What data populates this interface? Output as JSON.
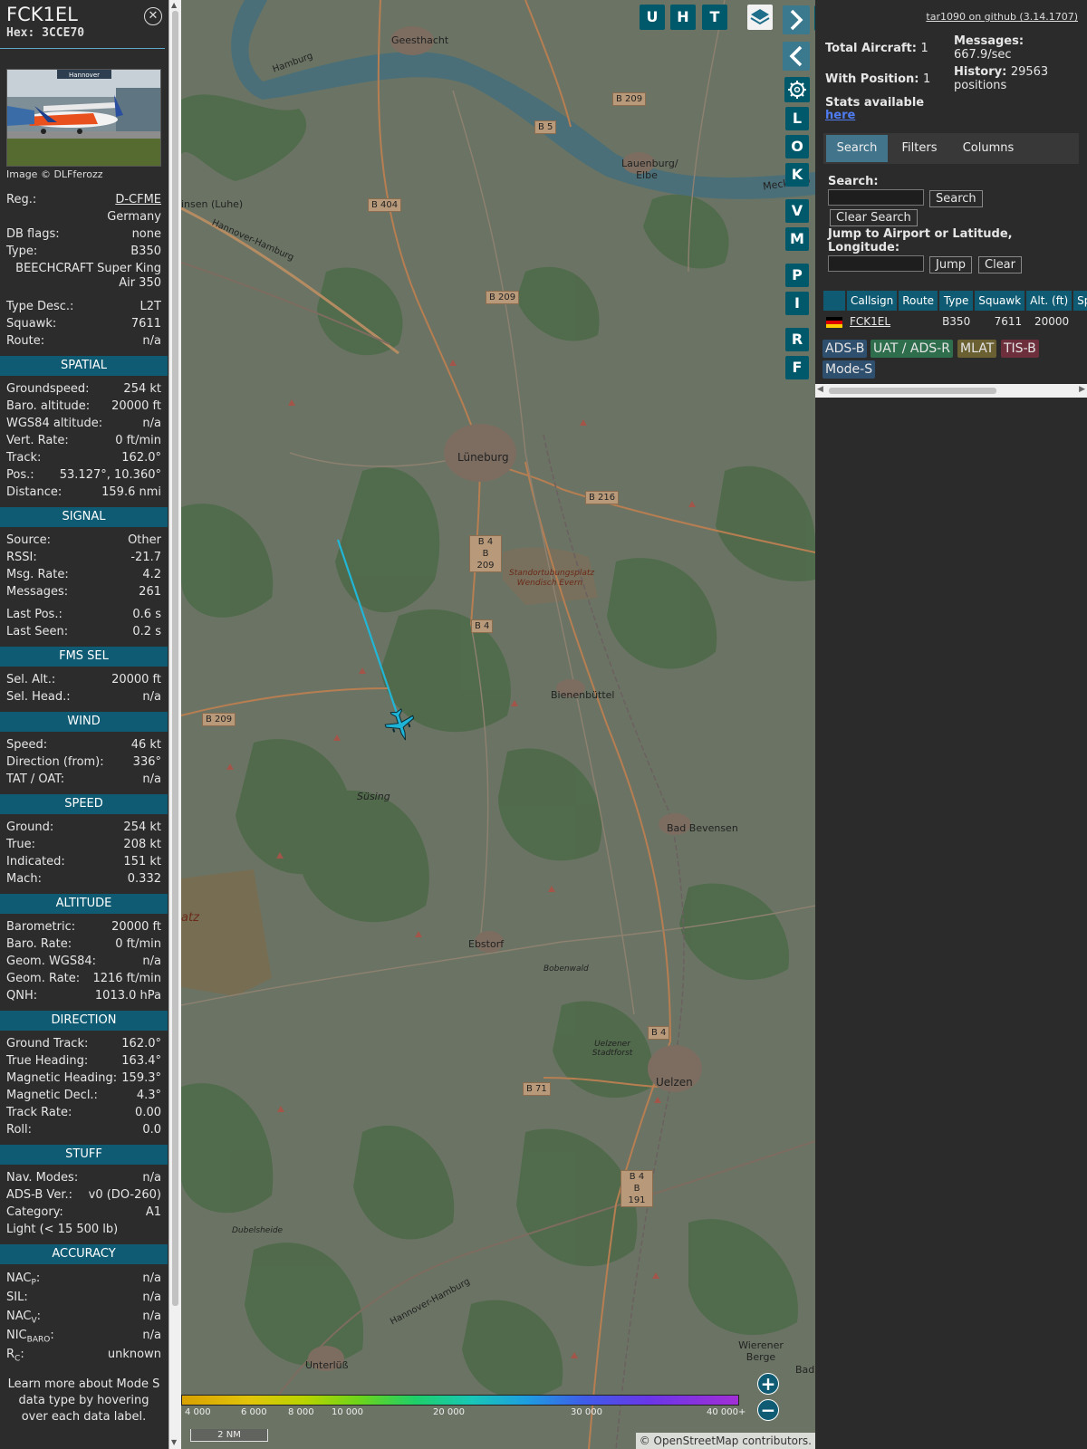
{
  "aircraft": {
    "callsign": "FCK1EL",
    "hex_label": "Hex: 3CCE70",
    "photo_credit": "Image © DLFferozz",
    "photo_banner": "Hannover",
    "reg_label": "Reg.:",
    "reg_value": "D-CFME",
    "country": "Germany",
    "dbflags_label": "DB flags:",
    "dbflags_value": "none",
    "type_label": "Type:",
    "type_value": "B350",
    "type_full": "BEECHCRAFT Super King Air 350",
    "typedesc_label": "Type Desc.:",
    "typedesc_value": "L2T",
    "squawk_label": "Squawk:",
    "squawk_value": "7611",
    "route_label": "Route:",
    "route_value": "n/a"
  },
  "sections": {
    "spatial": "SPATIAL",
    "signal": "SIGNAL",
    "fms": "FMS SEL",
    "wind": "WIND",
    "speed": "SPEED",
    "altitude": "ALTITUDE",
    "direction": "DIRECTION",
    "stuff": "STUFF",
    "accuracy": "ACCURACY"
  },
  "spatial": [
    {
      "label": "Groundspeed:",
      "value": "254 kt"
    },
    {
      "label": "Baro. altitude:",
      "value": "20000 ft"
    },
    {
      "label": "WGS84 altitude:",
      "value": "n/a"
    },
    {
      "label": "Vert. Rate:",
      "value": "0 ft/min"
    },
    {
      "label": "Track:",
      "value": "162.0°"
    },
    {
      "label": "Pos.:",
      "value": "53.127°, 10.360°"
    },
    {
      "label": "Distance:",
      "value": "159.6 nmi"
    }
  ],
  "signal": [
    {
      "label": "Source:",
      "value": "Other"
    },
    {
      "label": "RSSI:",
      "value": "-21.7"
    },
    {
      "label": "Msg. Rate:",
      "value": "4.2"
    },
    {
      "label": "Messages:",
      "value": "261"
    }
  ],
  "signal2": [
    {
      "label": "Last Pos.:",
      "value": "0.6 s"
    },
    {
      "label": "Last Seen:",
      "value": "0.2 s"
    }
  ],
  "fms": [
    {
      "label": "Sel. Alt.:",
      "value": "20000 ft"
    },
    {
      "label": "Sel. Head.:",
      "value": "n/a"
    }
  ],
  "wind": [
    {
      "label": "Speed:",
      "value": "46 kt"
    },
    {
      "label": "Direction (from):",
      "value": "336°"
    },
    {
      "label": "TAT / OAT:",
      "value": "n/a"
    }
  ],
  "speed": [
    {
      "label": "Ground:",
      "value": "254 kt"
    },
    {
      "label": "True:",
      "value": "208 kt"
    },
    {
      "label": "Indicated:",
      "value": "151 kt"
    },
    {
      "label": "Mach:",
      "value": "0.332"
    }
  ],
  "altitude": [
    {
      "label": "Barometric:",
      "value": "20000 ft"
    },
    {
      "label": "Baro. Rate:",
      "value": "0 ft/min"
    },
    {
      "label": "Geom. WGS84:",
      "value": "n/a"
    },
    {
      "label": "Geom. Rate:",
      "value": "1216 ft/min"
    },
    {
      "label": "QNH:",
      "value": "1013.0 hPa"
    }
  ],
  "direction": [
    {
      "label": "Ground Track:",
      "value": "162.0°"
    },
    {
      "label": "True Heading:",
      "value": "163.4°"
    },
    {
      "label": "Magnetic Heading:",
      "value": "159.3°"
    },
    {
      "label": "Magnetic Decl.:",
      "value": "4.3°"
    },
    {
      "label": "Track Rate:",
      "value": "0.00"
    },
    {
      "label": "Roll:",
      "value": "0.0"
    }
  ],
  "stuff": [
    {
      "label": "Nav. Modes:",
      "value": "n/a"
    },
    {
      "label": "ADS-B Ver.:",
      "value": "v0 (DO-260)"
    },
    {
      "label": "Category:",
      "value": "A1"
    }
  ],
  "stuff_category_desc": "Light (< 15 500 lb)",
  "accuracy": {
    "nacp_main": "NAC",
    "nacp_sub": "P",
    "nacp_value": "n/a",
    "sil_label": "SIL:",
    "sil_value": "n/a",
    "nacv_main": "NAC",
    "nacv_sub": "V",
    "nacv_value": "n/a",
    "nicbaro_main": "NIC",
    "nicbaro_sub": "BARO",
    "nicbaro_value": "n/a",
    "rc_main": "R",
    "rc_sub": "C",
    "rc_value": "unknown"
  },
  "left_note": "Learn more about Mode S data type by hovering over each data label.",
  "map": {
    "buttons": [
      "U",
      "H",
      "T"
    ],
    "side_buttons": [
      "L",
      "O",
      "K",
      "V",
      "M",
      "P",
      "I",
      "R",
      "F"
    ],
    "places": [
      "Geesthacht",
      "Lauenburg/ Elbe",
      "Mecklenb",
      "insen (Luhe)",
      "Hannover-Hamburg",
      "Lüneburg",
      "Bienenbüttel",
      "Süsing",
      "Bad Bevensen",
      "Ebstorf",
      "Bobenwald",
      "Uelzener Stadtforst",
      "Uelzen",
      "Dubelsheide",
      "Unterlüß",
      "Wierener Berge",
      "Bad",
      "atz",
      "Hannover-Hamburg",
      "Hamburg"
    ],
    "military_area": "Standortubungsplatz Wendisch Evern",
    "roads": [
      "B 209",
      "B 5",
      "B 404",
      "B 209",
      "B 216",
      "B 4",
      "B 209",
      "B 4",
      "B 209",
      "B 4",
      "B 71",
      "B 4",
      "B 191"
    ],
    "scale": "2 NM",
    "attribution": "© OpenStreetMap contributors.",
    "alt_ticks": [
      "4 000",
      "6 000",
      "8 000",
      "10 000",
      "20 000",
      "30 000",
      "40 000+"
    ],
    "zoom_in": "+",
    "zoom_out": "−"
  },
  "right": {
    "github": "tar1090 on github (3.14.1707)",
    "total_label": "Total Aircraft:",
    "total_value": "1",
    "position_label": "With Position:",
    "position_value": "1",
    "messages_label": "Messages:",
    "messages_value": "667.9/sec",
    "history_label": "History:",
    "history_value": "29563 positions",
    "stats_label": "Stats available",
    "stats_link": "here",
    "tabs": [
      "Search",
      "Filters",
      "Columns"
    ],
    "search_label": "Search:",
    "search_btn": "Search",
    "clear_search_btn": "Clear Search",
    "jump_label": "Jump to Airport or Latitude, Longitude:",
    "jump_btn": "Jump",
    "clear_btn": "Clear",
    "columns": [
      "Callsign",
      "Route",
      "Type",
      "Squawk",
      "Alt. (ft)",
      "Spd."
    ],
    "row": {
      "callsign": "FCK1EL",
      "route": "",
      "type": "B350",
      "squawk": "7611",
      "alt": "20000",
      "spd": ""
    },
    "legend": [
      "ADS-B",
      "UAT / ADS-R",
      "MLAT",
      "TIS-B",
      "Mode-S"
    ]
  },
  "colors": {
    "accent": "#0e5b73",
    "track": "#21b6d6",
    "adsb": "#2f4f6e",
    "uat": "#2f6e4c",
    "mlat": "#6b6032",
    "tisb": "#6e2f3d"
  }
}
